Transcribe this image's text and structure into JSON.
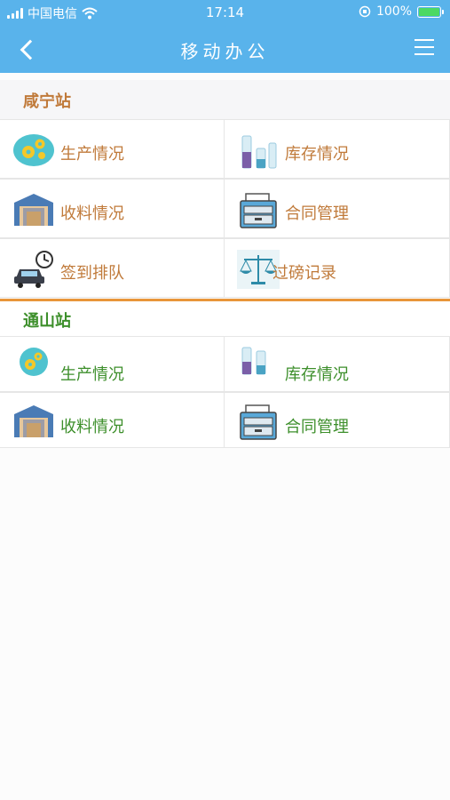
{
  "status_bar": {
    "carrier": "中国电信",
    "time": "17:14",
    "battery": "100%",
    "icons": [
      "signal-icon",
      "wifi-icon",
      "orientation-lock-icon",
      "battery-charging-icon"
    ]
  },
  "nav": {
    "title": "移动办公",
    "back_icon": "chevron-left-icon",
    "menu_icon": "hamburger-menu-icon"
  },
  "colors": {
    "header": "#59b3eb",
    "station1_text": "#c07a3a",
    "station2_text": "#3d8f2b",
    "divider": "#e8963a"
  },
  "stations": [
    {
      "name": "咸宁站",
      "items": [
        {
          "label": "生产情况",
          "icon": "gears-icon"
        },
        {
          "label": "库存情况",
          "icon": "test-tubes-icon"
        },
        {
          "label": "收料情况",
          "icon": "warehouse-icon"
        },
        {
          "label": "合同管理",
          "icon": "file-cabinet-icon"
        },
        {
          "label": "签到排队",
          "icon": "car-clock-icon"
        },
        {
          "label": "过磅记录",
          "icon": "scale-icon"
        }
      ]
    },
    {
      "name": "通山站",
      "items": [
        {
          "label": "生产情况",
          "icon": "gears-icon"
        },
        {
          "label": "库存情况",
          "icon": "test-tubes-icon"
        },
        {
          "label": "收料情况",
          "icon": "warehouse-icon"
        },
        {
          "label": "合同管理",
          "icon": "file-cabinet-icon"
        }
      ]
    }
  ]
}
